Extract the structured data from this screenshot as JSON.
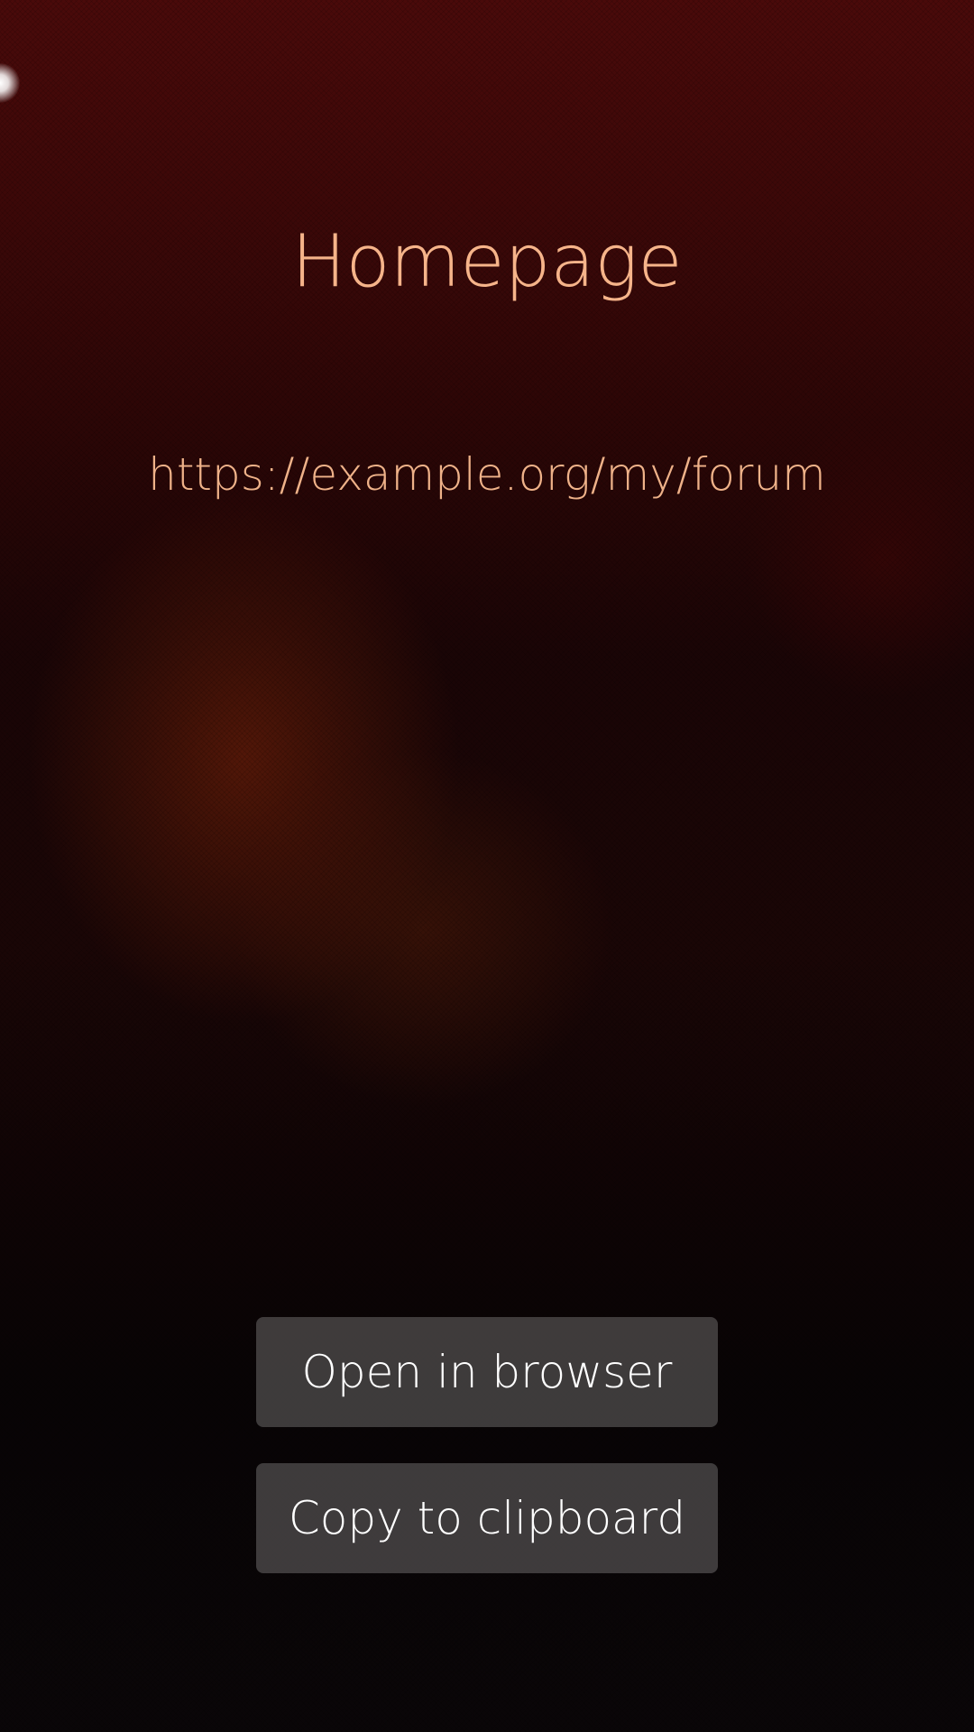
{
  "page": {
    "title": "Homepage",
    "url_text": "https://example.org/my/forum"
  },
  "buttons": {
    "open_label": "Open in browser",
    "copy_label": "Copy to clipboard"
  },
  "colors": {
    "accent_text": "#f6b48a",
    "button_background": "rgba(255,255,255,0.22)",
    "button_text": "#ffffff"
  },
  "icons": {
    "pulley_indicator": "glow-dot-icon"
  }
}
